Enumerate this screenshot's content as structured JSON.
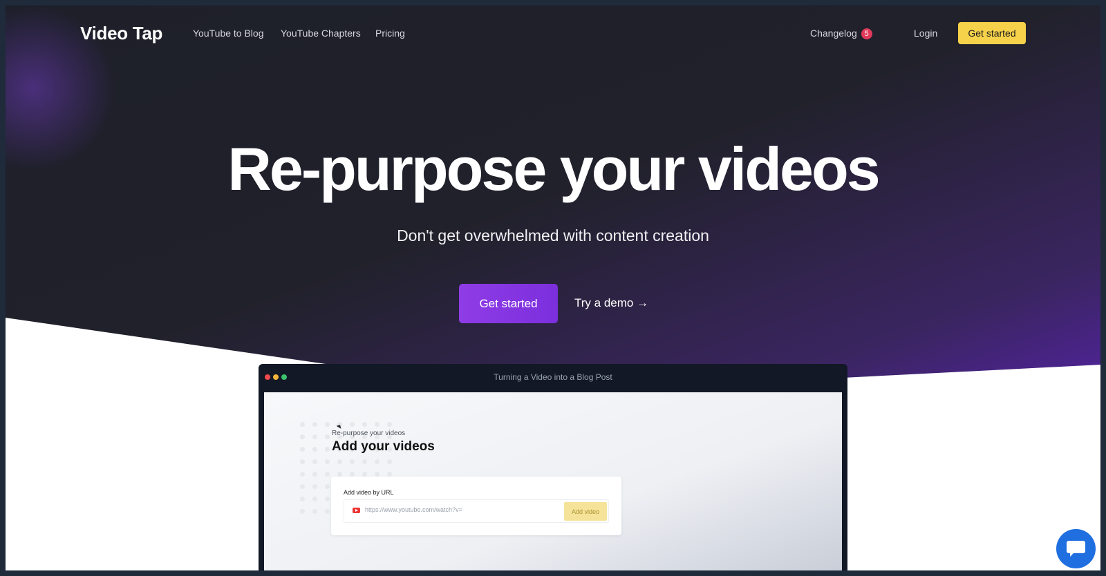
{
  "nav": {
    "logo": "Video Tap",
    "links": [
      "YouTube to Blog",
      "YouTube Chapters",
      "Pricing"
    ],
    "changelog_label": "Changelog",
    "changelog_count": "5",
    "login_label": "Login",
    "cta_label": "Get started"
  },
  "hero": {
    "headline": "Re-purpose your videos",
    "subheadline": "Don't get overwhelmed with content creation",
    "primary_cta": "Get started",
    "secondary_cta": "Try a demo →"
  },
  "demo_window": {
    "title": "Turning a Video into a Blog Post",
    "kicker": "Re-purpose your videos",
    "heading": "Add your videos",
    "card_label": "Add video by URL",
    "url_placeholder": "https://www.youtube.com/watch?v=",
    "add_button": "Add video"
  },
  "colors": {
    "accent_yellow": "#f6d24a",
    "accent_purple": "#8f3ce6",
    "chat_blue": "#1f6fe0"
  },
  "icons": [
    "youtube-icon",
    "chat-icon",
    "cursor-icon"
  ]
}
